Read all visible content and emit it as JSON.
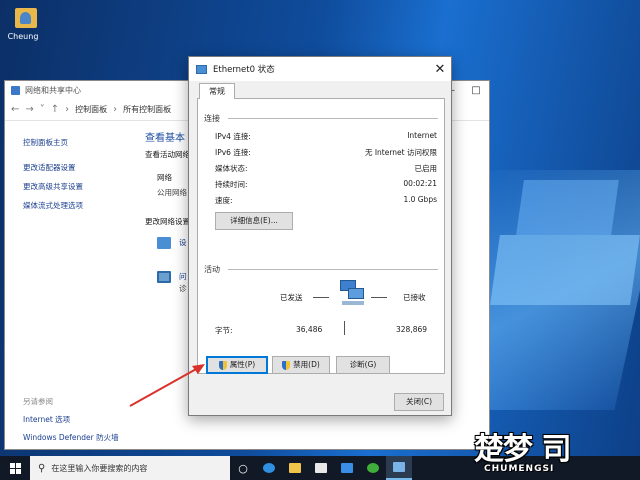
{
  "desktop": {
    "icon_label": "Cheung"
  },
  "bg_window": {
    "title": "网络和共享中心",
    "breadcrumb": [
      "控制面板",
      "所有控制面板"
    ],
    "sidebar": {
      "home": "控制面板主页",
      "links": [
        "更改适配器设置",
        "更改高级共享设置",
        "媒体流式处理选项"
      ],
      "see_also_header": "另请参阅",
      "see_also": [
        "Internet 选项",
        "Windows Defender 防火墙"
      ]
    },
    "main": {
      "heading": "查看基本",
      "sub": "查看活动网络",
      "network_label": "网络",
      "network_type": "公用网络",
      "change_label": "更改网络设置",
      "item1": "设",
      "item2": "问",
      "item2b": "诊"
    }
  },
  "dialog": {
    "title": "Ethernet0 状态",
    "tab": "常规",
    "connection_group": "连接",
    "rows": [
      {
        "label": "IPv4 连接:",
        "value": "Internet"
      },
      {
        "label": "IPv6 连接:",
        "value": "无 Internet 访问权限"
      },
      {
        "label": "媒体状态:",
        "value": "已启用"
      },
      {
        "label": "持续时间:",
        "value": "00:02:21"
      },
      {
        "label": "速度:",
        "value": "1.0 Gbps"
      }
    ],
    "details_button": "详细信息(E)...",
    "activity_group": "活动",
    "sent_label": "已发送",
    "received_label": "已接收",
    "bytes_label": "字节:",
    "bytes_sent": "36,486",
    "bytes_received": "328,869",
    "properties_button": "属性(P)",
    "disable_button": "禁用(D)",
    "diagnose_button": "诊断(G)",
    "close_button": "关闭(C)"
  },
  "taskbar": {
    "search_placeholder": "在这里输入你要搜索的内容",
    "icons": [
      "start-icon",
      "task-view-icon",
      "edge-icon",
      "file-explorer-icon",
      "store-icon",
      "mail-icon",
      "xbox-icon",
      "network-center-icon"
    ]
  },
  "watermark": {
    "big": "楚梦 司",
    "small": "CHUMENGSI"
  },
  "colors": {
    "accent": "#0078d7",
    "arrow": "#d9322b",
    "link": "#1b3f8f"
  }
}
